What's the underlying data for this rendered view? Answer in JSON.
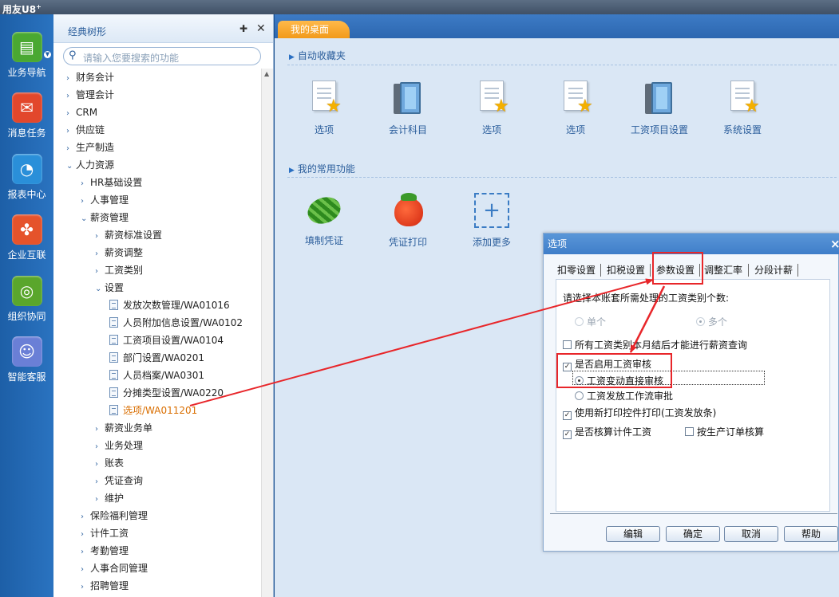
{
  "app": {
    "brand": "用友U8",
    "brand_sup": "+"
  },
  "leftbar": {
    "items": [
      {
        "label": "业务导航",
        "icon": "business-navigation-icon",
        "color": "#4aa832"
      },
      {
        "label": "消息任务",
        "icon": "message-task-icon",
        "color": "#e2472c"
      },
      {
        "label": "报表中心",
        "icon": "report-center-icon",
        "color": "#2a8fd9"
      },
      {
        "label": "企业互联",
        "icon": "enterprise-connect-icon",
        "color": "#e5532b"
      },
      {
        "label": "组织协同",
        "icon": "organization-collab-icon",
        "color": "#5aa62c"
      },
      {
        "label": "智能客服",
        "icon": "smart-service-icon",
        "color": "#6a7fd6"
      }
    ]
  },
  "tree": {
    "title": "经典树形",
    "search_placeholder": "请输入您要搜索的功能",
    "nodes": [
      {
        "label": "财务会计",
        "arrow": "›"
      },
      {
        "label": "管理会计",
        "arrow": "›"
      },
      {
        "label": "CRM",
        "arrow": "›"
      },
      {
        "label": "供应链",
        "arrow": "›"
      },
      {
        "label": "生产制造",
        "arrow": "›"
      },
      {
        "label": "人力资源",
        "arrow": "⌄"
      },
      {
        "label": "HR基础设置",
        "arrow": "›"
      },
      {
        "label": "人事管理",
        "arrow": "›"
      },
      {
        "label": "薪资管理",
        "arrow": "⌄"
      },
      {
        "label": "薪资标准设置",
        "arrow": "›"
      },
      {
        "label": "薪资调整",
        "arrow": "›"
      },
      {
        "label": "工资类别",
        "arrow": "›"
      },
      {
        "label": "设置",
        "arrow": "⌄"
      },
      {
        "label": "发放次数管理/WA01016"
      },
      {
        "label": "人员附加信息设置/WA0102"
      },
      {
        "label": "工资项目设置/WA0104"
      },
      {
        "label": "部门设置/WA0201"
      },
      {
        "label": "人员档案/WA0301"
      },
      {
        "label": "分摊类型设置/WA0220"
      },
      {
        "label": "选项/WA011201"
      },
      {
        "label": "薪资业务单",
        "arrow": "›"
      },
      {
        "label": "业务处理",
        "arrow": "›"
      },
      {
        "label": "账表",
        "arrow": "›"
      },
      {
        "label": "凭证查询",
        "arrow": "›"
      },
      {
        "label": "维护",
        "arrow": "›"
      },
      {
        "label": "保险福利管理",
        "arrow": "›"
      },
      {
        "label": "计件工资",
        "arrow": "›"
      },
      {
        "label": "考勤管理",
        "arrow": "›"
      },
      {
        "label": "人事合同管理",
        "arrow": "›"
      },
      {
        "label": "招聘管理",
        "arrow": "›"
      }
    ]
  },
  "desktop": {
    "tab_label": "我的桌面",
    "favorites_title": "自动收藏夹",
    "favorites": [
      {
        "label": "选项",
        "icon": "document-star-icon"
      },
      {
        "label": "会计科目",
        "icon": "books-icon"
      },
      {
        "label": "选项",
        "icon": "document-star-icon"
      },
      {
        "label": "选项",
        "icon": "document-star-icon"
      },
      {
        "label": "工资项目设置",
        "icon": "books-icon"
      },
      {
        "label": "系统设置",
        "icon": "document-star-icon"
      }
    ],
    "common_title": "我的常用功能",
    "common": [
      {
        "label": "填制凭证",
        "icon": "watermelon-icon"
      },
      {
        "label": "凭证打印",
        "icon": "strawberry-icon"
      },
      {
        "label": "添加更多",
        "icon": "add-more-icon"
      }
    ]
  },
  "dialog": {
    "title": "选项",
    "close": "×",
    "tabs": [
      "扣零设置",
      "扣税设置",
      "参数设置",
      "调整汇率",
      "分段计薪"
    ],
    "question": "请选择本账套所需处理的工资类别个数:",
    "single": "单个",
    "multiple": "多个",
    "opt_all_month_end": "所有工资类别本月结后才能进行薪资查询",
    "opt_enable_audit": "是否启用工资审核",
    "opt_direct_audit": "工资变动直接审核",
    "opt_workflow_audit": "工资发放工作流审批",
    "opt_new_print": "使用新打印控件打印(工资发放条)",
    "opt_piece_wage": "是否核算计件工资",
    "opt_by_order": "按生产订单核算",
    "check_mark": "✓",
    "buttons": [
      "编辑",
      "确定",
      "取消",
      "帮助"
    ]
  }
}
